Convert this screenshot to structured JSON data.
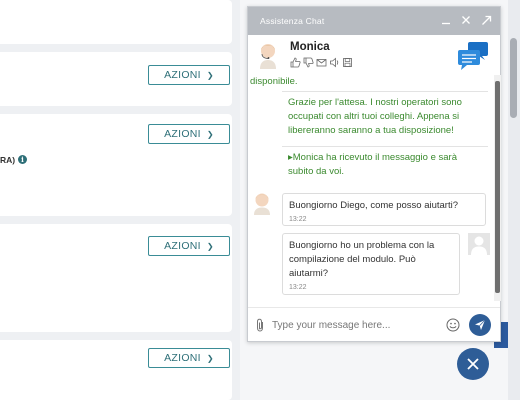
{
  "background": {
    "cards": [
      {
        "button_label": "AZIONI"
      },
      {
        "button_label": "AZIONI"
      },
      {
        "button_label": "AZIONI"
      },
      {
        "button_label": "AZIONI"
      }
    ],
    "truncated_label": "RA)",
    "info_icon": "info-icon"
  },
  "chat": {
    "title": "Assistenza Chat",
    "header_icons": [
      "minimize-icon",
      "close-icon",
      "expand-icon"
    ],
    "agent": {
      "name": "Monica",
      "tools": [
        "thumbs-up-icon",
        "thumbs-down-icon",
        "email-icon",
        "speaker-icon",
        "save-icon"
      ]
    },
    "messages": {
      "system_partial": "disponibile.",
      "system_wait": "Grazie per l'attesa. I nostri operatori sono occupati con altri tuoi colleghi. Appena si libereranno saranno a tua disposizione!",
      "system_received": "▸Monica ha ricevuto il messaggio e sarà subito da voi.",
      "agent_text": "Buongiorno Diego, come posso aiutarti?",
      "agent_time": "13:22",
      "user_text": "Buongiorno ho un problema con la compilazione del modulo. Può aiutarmi?",
      "user_time": "13:22"
    },
    "input": {
      "placeholder": "Type your message here...",
      "value": ""
    }
  },
  "colors": {
    "accent": "#2e5d97",
    "system_text": "#3b8a2f",
    "header_bg": "#b7bbc1",
    "button_border": "#3a8c96"
  }
}
